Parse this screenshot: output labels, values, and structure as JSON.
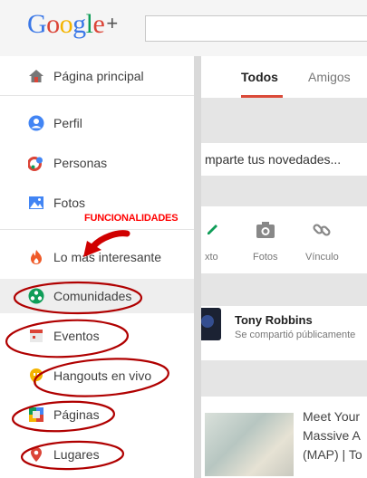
{
  "header": {
    "logo_text": "Google",
    "logo_plus": "+"
  },
  "sidebar": {
    "items": [
      {
        "label": "Página principal",
        "icon": "home-icon"
      },
      {
        "label": "Perfil",
        "icon": "profile-icon"
      },
      {
        "label": "Personas",
        "icon": "people-icon"
      },
      {
        "label": "Fotos",
        "icon": "photos-icon"
      },
      {
        "label": "Lo más interesante",
        "icon": "flame-icon"
      },
      {
        "label": "Comunidades",
        "icon": "communities-icon"
      },
      {
        "label": "Eventos",
        "icon": "calendar-icon"
      },
      {
        "label": "Hangouts en vivo",
        "icon": "hangouts-icon"
      },
      {
        "label": "Páginas",
        "icon": "pages-icon"
      },
      {
        "label": "Lugares",
        "icon": "location-pin-icon"
      }
    ]
  },
  "main": {
    "tabs": [
      {
        "label": "Todos"
      },
      {
        "label": "Amigos"
      }
    ],
    "share": {
      "prompt": "mparte tus novedades...",
      "actions": [
        {
          "label": "xto"
        },
        {
          "label": "Fotos"
        },
        {
          "label": "Vínculo"
        }
      ]
    },
    "post": {
      "author": "Tony Robbins",
      "subtitle": "Se compartió públicamente"
    },
    "link_card": {
      "lines": [
        "Meet Your",
        "Massive A",
        "(MAP) | To"
      ]
    }
  },
  "annotation": {
    "label": "FUNCIONALIDADES",
    "color": "#ff0000"
  },
  "colors": {
    "accent_red": "#db4a39",
    "text": "#404040"
  }
}
